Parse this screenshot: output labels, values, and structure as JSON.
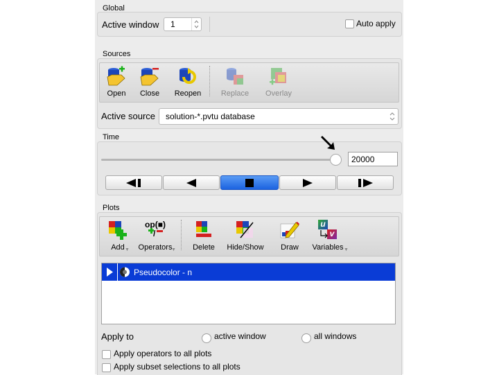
{
  "global": {
    "section_title": "Global",
    "active_window_label": "Active window",
    "active_window_value": "1",
    "auto_apply_label": "Auto apply",
    "auto_apply_checked": false
  },
  "sources": {
    "section_title": "Sources",
    "toolbar": [
      {
        "label": "Open",
        "icon": "open-database-icon",
        "enabled": true
      },
      {
        "label": "Close",
        "icon": "close-database-icon",
        "enabled": true
      },
      {
        "label": "Reopen",
        "icon": "reopen-database-icon",
        "enabled": true
      },
      {
        "label": "Replace",
        "icon": "replace-database-icon",
        "enabled": false
      },
      {
        "label": "Overlay",
        "icon": "overlay-database-icon",
        "enabled": false
      }
    ],
    "active_source_label": "Active source",
    "active_source_value": "solution-*.pvtu database"
  },
  "time": {
    "section_title": "Time",
    "slider_fraction": 1.0,
    "time_value": "20000",
    "playback_buttons": [
      "step-back",
      "play-reverse",
      "stop",
      "play",
      "step-forward"
    ]
  },
  "plots": {
    "section_title": "Plots",
    "toolbar": [
      {
        "label": "Add",
        "icon": "add-plot-icon",
        "has_menu": true
      },
      {
        "label": "Operators",
        "icon": "operators-icon",
        "has_menu": true,
        "icon_text": "op(■)"
      },
      {
        "label": "Delete",
        "icon": "delete-plot-icon",
        "has_menu": false
      },
      {
        "label": "Hide/Show",
        "icon": "hide-show-icon",
        "has_menu": false
      },
      {
        "label": "Draw",
        "icon": "draw-icon",
        "has_menu": false
      },
      {
        "label": "Variables",
        "icon": "variables-icon",
        "has_menu": true,
        "icon_text_u": "u",
        "icon_text_v": "v"
      }
    ],
    "plot_list": [
      {
        "label": "Pseudocolor - n",
        "selected": true
      }
    ],
    "apply_to_label": "Apply to",
    "apply_to_options": [
      "active window",
      "all windows"
    ],
    "apply_operators_label": "Apply operators to all plots",
    "apply_subset_label": "Apply subset selections to all plots"
  },
  "colors": {
    "selection_blue": "#0a3cd6",
    "panel_bg": "#ececec"
  }
}
